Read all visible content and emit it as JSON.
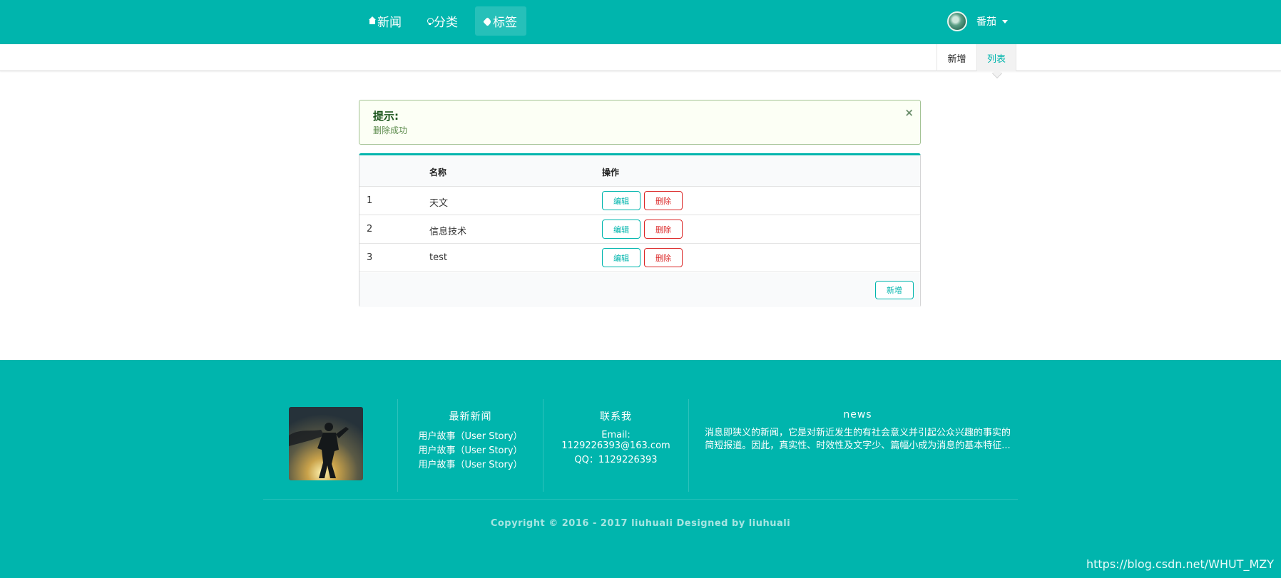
{
  "nav": {
    "items": [
      {
        "label": "新闻",
        "icon": "home-icon"
      },
      {
        "label": "分类",
        "icon": "lightbulb-icon"
      },
      {
        "label": "标签",
        "icon": "tag-icon",
        "active": true
      }
    ],
    "user": {
      "name": "番茄"
    }
  },
  "submenu": {
    "items": [
      {
        "label": "新增"
      },
      {
        "label": "列表",
        "active": true
      }
    ]
  },
  "alert": {
    "title": "提示:",
    "message": "删除成功",
    "close": "×"
  },
  "table": {
    "headers": {
      "name": "名称",
      "action": "操作"
    },
    "rows": [
      {
        "id": "1",
        "name": "天文",
        "edit": "编辑",
        "delete": "删除"
      },
      {
        "id": "2",
        "name": "信息技术",
        "edit": "编辑",
        "delete": "删除"
      },
      {
        "id": "3",
        "name": "test",
        "edit": "编辑",
        "delete": "删除"
      }
    ],
    "add_label": "新增"
  },
  "footer": {
    "latest_news": {
      "title": "最新新闻",
      "items": [
        "用户故事（User Story）",
        "用户故事（User Story）",
        "用户故事（User Story）"
      ]
    },
    "contact": {
      "title": "联系我",
      "email_label": "Email:",
      "email": "1129226393@163.com",
      "qq": "QQ：1129226393"
    },
    "news": {
      "title": "news",
      "text": "消息即狭义的新闻，它是对新近发生的有社会意义并引起公众兴趣的事实的简短报道。因此，真实性、时效性及文字少、篇幅小成为消息的基本特征..."
    },
    "copyright": "Copyright © 2016 - 2017 liuhuali Designed by liuhuali"
  },
  "watermark": "https://blog.csdn.net/WHUT_MZY",
  "colors": {
    "primary": "#00b5ad",
    "danger": "#db2828",
    "success_bg": "#fcfff5"
  }
}
